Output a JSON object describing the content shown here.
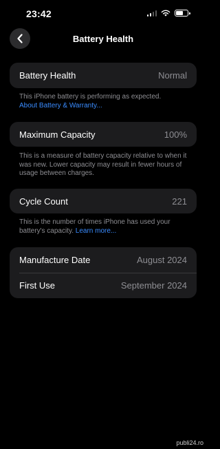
{
  "status_bar": {
    "time": "23:42"
  },
  "nav": {
    "title": "Battery Health"
  },
  "battery_health": {
    "label": "Battery Health",
    "value": "Normal",
    "footnote": "This iPhone battery is performing as expected.",
    "link": "About Battery & Warranty..."
  },
  "maximum_capacity": {
    "label": "Maximum Capacity",
    "value": "100%",
    "footnote": "This is a measure of battery capacity relative to when it was new. Lower capacity may result in fewer hours of usage between charges."
  },
  "cycle_count": {
    "label": "Cycle Count",
    "value": "221",
    "footnote": "This is the number of times iPhone has used your battery's capacity.",
    "link": "Learn more..."
  },
  "dates": {
    "manufacture_label": "Manufacture Date",
    "manufacture_value": "August 2024",
    "first_use_label": "First Use",
    "first_use_value": "September 2024"
  },
  "watermark": "publi24.ro",
  "colors": {
    "background": "#000000",
    "card": "#1c1c1e",
    "secondary_text": "#8e8e93",
    "link": "#3a8cff"
  }
}
